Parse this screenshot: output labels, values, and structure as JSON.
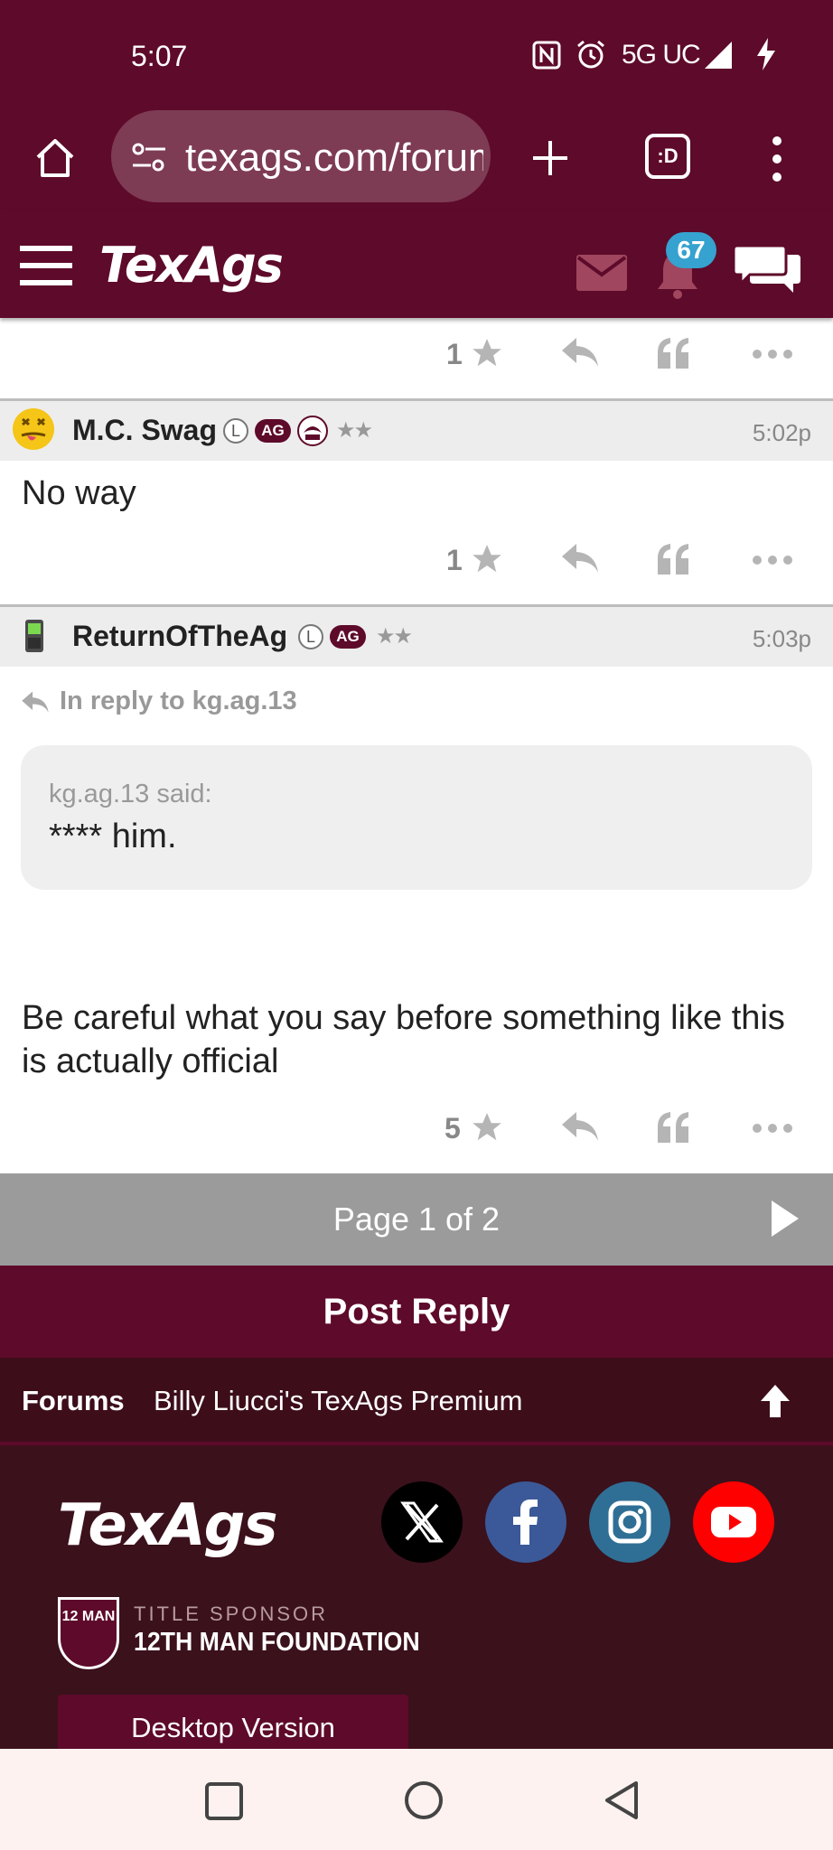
{
  "status_bar": {
    "time": "5:07",
    "network": "5G UC"
  },
  "browser": {
    "url": "texags.com/forums",
    "tab_icon_label": ":D"
  },
  "site_header": {
    "logo": "TexAgs",
    "notification_count": "67"
  },
  "posts": [
    {
      "star_count": "1"
    },
    {
      "username": "M.C. Swag",
      "badge_l": "L",
      "badge_ag": "AG",
      "rank": "★★",
      "time": "5:02p",
      "body": "No way",
      "star_count": "1"
    },
    {
      "username": "ReturnOfTheAg",
      "badge_l": "L",
      "badge_ag": "AG",
      "rank": "★★",
      "time": "5:03p",
      "reply_to": "In reply to kg.ag.13",
      "quote_author": "kg.ag.13 said:",
      "quote_text": "**** him.",
      "body": "Be careful what you say before something like this is actually official",
      "star_count": "5"
    }
  ],
  "pagination": {
    "label": "Page 1 of 2"
  },
  "post_reply_label": "Post Reply",
  "breadcrumb": {
    "forums": "Forums",
    "board": "Billy Liucci's TexAgs Premium"
  },
  "footer": {
    "logo": "TexAgs",
    "sponsor_label": "TITLE SPONSOR",
    "sponsor_name": "12TH MAN FOUNDATION",
    "sponsor_emblem": "12 MAN",
    "desktop_version": "Desktop Version"
  },
  "colors": {
    "maroon": "#5e0a2a",
    "dark_maroon": "#3b111c",
    "badge_blue": "#36a2cf",
    "facebook": "#3b5998",
    "instagram": "#2f6f95",
    "youtube": "#ff0000"
  }
}
